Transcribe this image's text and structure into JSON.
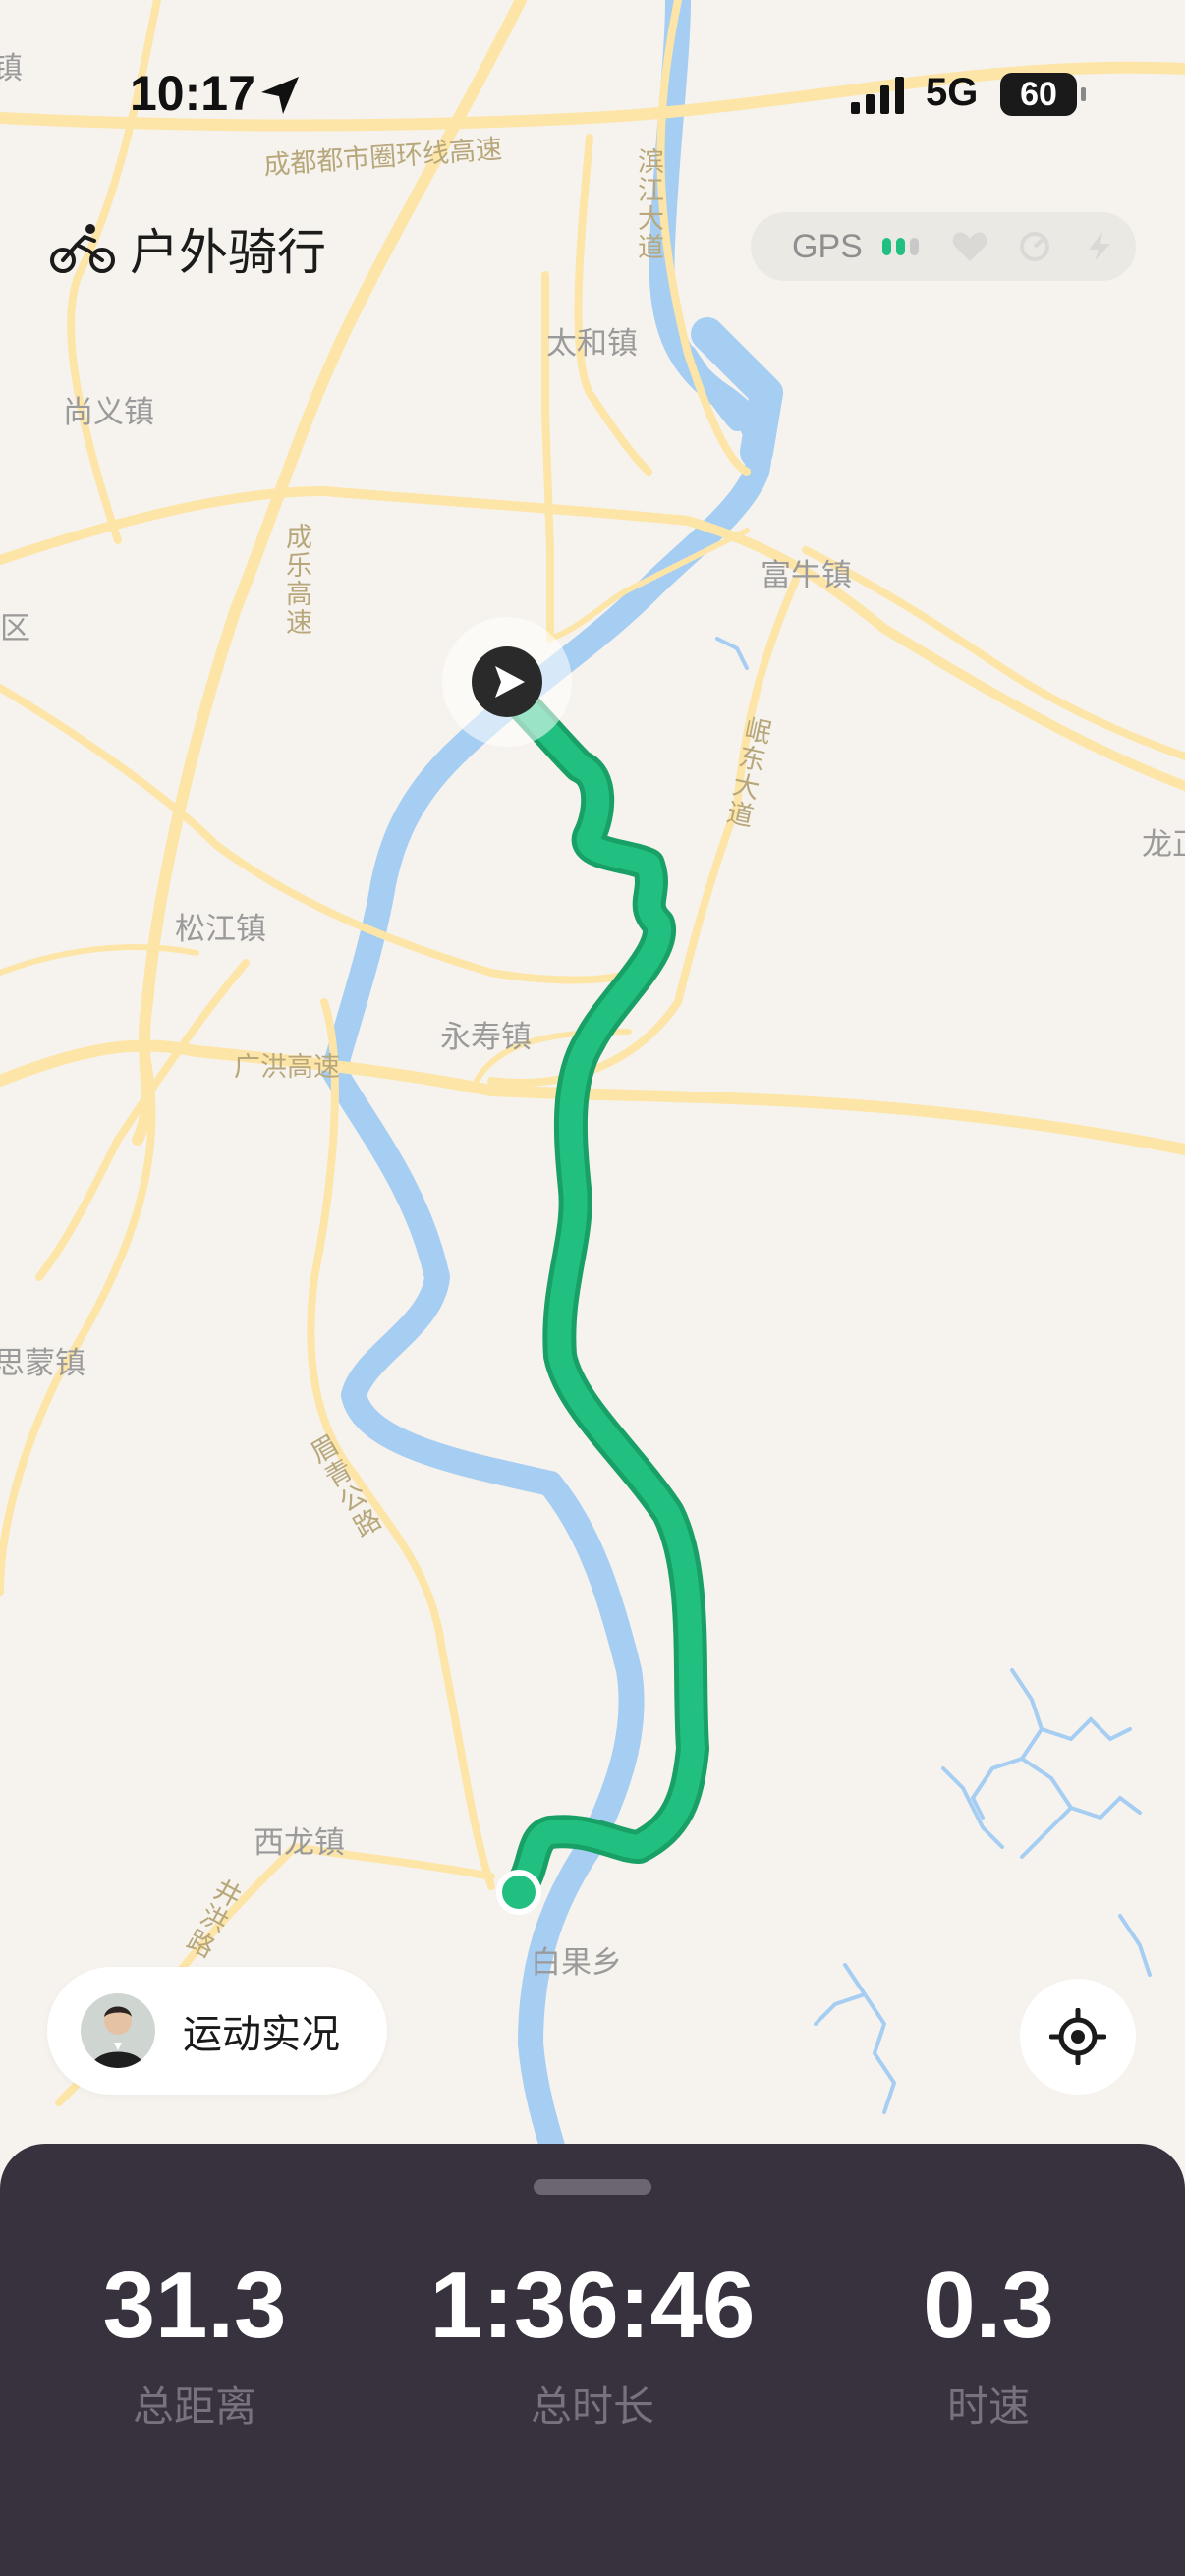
{
  "status_bar": {
    "time": "10:17",
    "network": "5G",
    "battery": "60"
  },
  "header": {
    "title": "户外骑行",
    "gps_label": "GPS"
  },
  "map": {
    "place_labels": [
      "太和镇",
      "尚义镇",
      "富牛镇",
      "松江镇",
      "永寿镇",
      "思蒙镇",
      "西龙镇",
      "白果乡",
      "龙正",
      "区",
      "镇"
    ],
    "road_labels": [
      "成都都市圈环线高速",
      "滨江大道",
      "成乐高速",
      "岷东大道",
      "广洪高速",
      "眉青公路",
      "井洪路"
    ],
    "route_color": "#22c080",
    "river_color": "#a6cdf2",
    "road_color": "#fde5a8"
  },
  "live_button": {
    "label": "运动实况"
  },
  "stats": [
    {
      "value": "31.3",
      "label": "总距离"
    },
    {
      "value": "1:36:46",
      "label": "总时长"
    },
    {
      "value": "0.3",
      "label": "时速"
    }
  ],
  "icons": {
    "cycling": "bicycle-icon",
    "locate": "locate-target-icon",
    "navigation": "navigation-arrow-icon"
  }
}
